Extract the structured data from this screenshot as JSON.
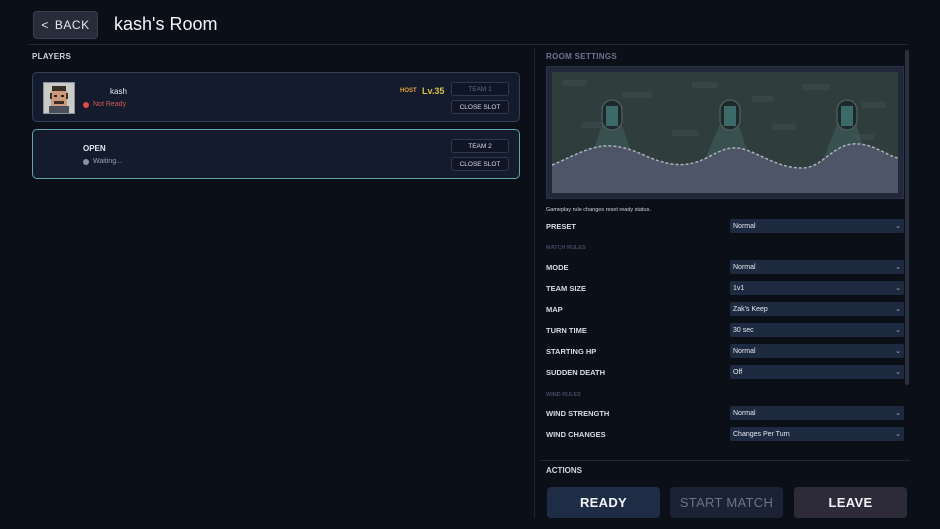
{
  "header": {
    "back_label": "BACK",
    "title": "kash's Room"
  },
  "players": {
    "heading": "PLAYERS",
    "slots": [
      {
        "tag": "",
        "name": "kash",
        "status": "Not Ready",
        "status_color": "#e04a4a",
        "host_badge": "HOST",
        "level": "Lv.35",
        "team_button": "TEAM 1",
        "close_button": "CLOSE SLOT"
      },
      {
        "name": "OPEN",
        "status": "Waiting...",
        "status_color": "#8a93a3",
        "team_button": "TEAM 2",
        "close_button": "CLOSE SLOT"
      }
    ]
  },
  "settings": {
    "heading": "ROOM SETTINGS",
    "note": "Gameplay rule changes reset ready status.",
    "preset": {
      "label": "PRESET",
      "value": "Normal"
    },
    "match_rules_heading": "MATCH RULES",
    "match_rules": [
      {
        "label": "MODE",
        "value": "Normal"
      },
      {
        "label": "TEAM SIZE",
        "value": "1v1"
      },
      {
        "label": "MAP",
        "value": "Zak's Keep"
      },
      {
        "label": "TURN TIME",
        "value": "30 sec"
      },
      {
        "label": "STARTING HP",
        "value": "Normal"
      },
      {
        "label": "SUDDEN DEATH",
        "value": "Off"
      }
    ],
    "wind_rules_heading": "WIND RULES",
    "wind_rules": [
      {
        "label": "WIND STRENGTH",
        "value": "Normal"
      },
      {
        "label": "WIND CHANGES",
        "value": "Changes Per Turn"
      }
    ]
  },
  "actions": {
    "heading": "ACTIONS",
    "ready": "READY",
    "start": "START MATCH",
    "leave": "LEAVE"
  },
  "icons": {
    "back": "chevron-left-icon",
    "dropdown": "chevron-down-icon"
  },
  "colors": {
    "background": "#0b0f18",
    "open_slot_border": "#5fa8a8",
    "host_badge": "#e7a23a",
    "level": "#d6c245"
  }
}
